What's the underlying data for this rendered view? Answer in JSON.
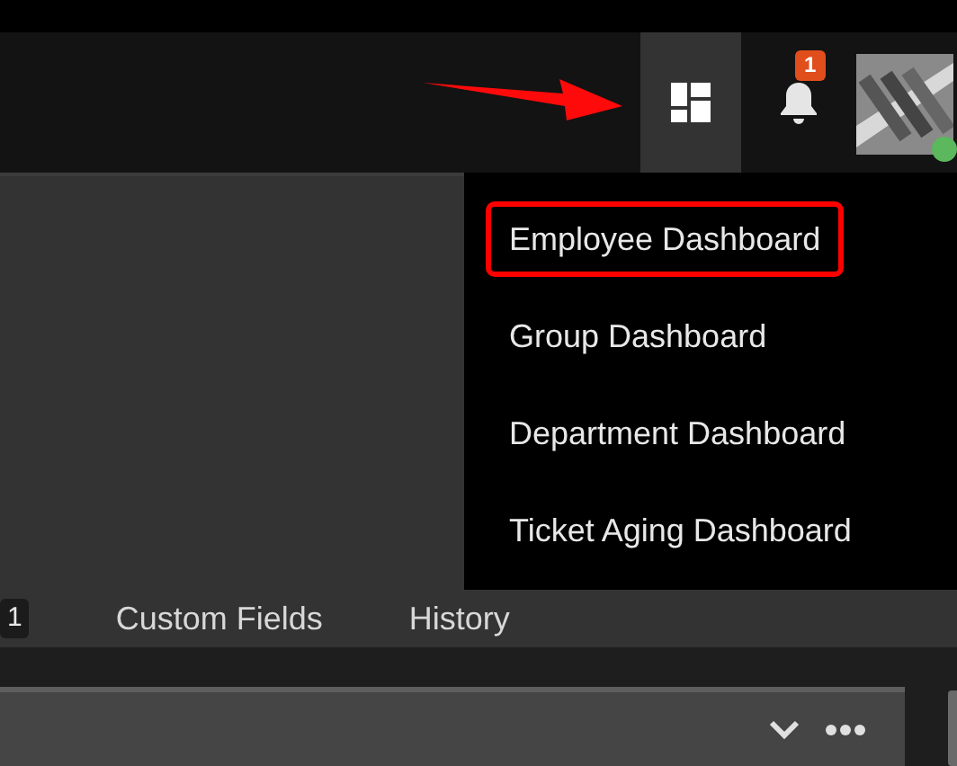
{
  "header": {
    "notifications": {
      "count": "1"
    },
    "avatar": {
      "online": true
    }
  },
  "dashboard_menu": {
    "open": true,
    "items": [
      {
        "label": "Employee Dashboard",
        "highlighted": true
      },
      {
        "label": "Group Dashboard",
        "highlighted": false
      },
      {
        "label": "Department Dashboard",
        "highlighted": false
      },
      {
        "label": "Ticket Aging Dashboard",
        "highlighted": false
      }
    ]
  },
  "tabs": [
    {
      "kind": "count",
      "label": "1"
    },
    {
      "kind": "tab",
      "label": "Custom Fields"
    },
    {
      "kind": "tab",
      "label": "History"
    }
  ]
}
